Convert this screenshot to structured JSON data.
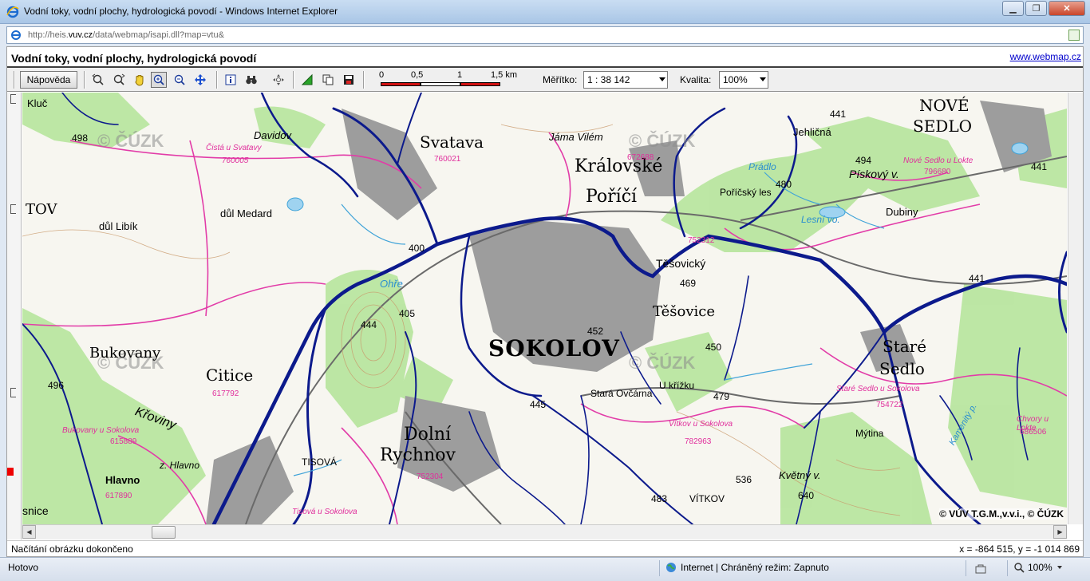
{
  "window": {
    "title": "Vodní toky, vodní plochy, hydrologická povodí - Windows Internet Explorer",
    "minimize": "▁",
    "maximize": "❐",
    "close": "✕"
  },
  "address": {
    "url_prefix": "http://heis.",
    "url_host": "vuv.cz",
    "url_rest": "/data/webmap/isapi.dll?map=vtu&"
  },
  "app": {
    "title": "Vodní toky, vodní plochy, hydrologická povodí",
    "link": "www.webmap.cz"
  },
  "toolbar": {
    "help_label": "Nápověda",
    "tools": [
      "zoom-in-step-icon",
      "zoom-out-step-icon",
      "pan-hand-icon",
      "zoom-in-icon",
      "zoom-out-icon",
      "full-extent-icon",
      "info-icon",
      "search-binoculars-icon",
      "center-icon",
      "select-icon",
      "copy-icon",
      "save-icon"
    ],
    "scale_labels": [
      "0",
      "0,5",
      "1",
      "1,5 km"
    ],
    "scale_label": "Měřítko:",
    "scale_value": "1 : 38 142",
    "quality_label": "Kvalita:",
    "quality_value": "100%"
  },
  "map": {
    "watermarks": [
      "© ČÚZK",
      "© ČÚZK",
      "© ČÚZK",
      "© ČÚZK"
    ],
    "labels": {
      "klic": "Kluč",
      "davidov": "Davidov",
      "cista": "Čistá u Svatavy",
      "cista_code": "760005",
      "svatava": "Svatava",
      "svatava_code": "760021",
      "jama": "Jáma Vilém",
      "kralovske": "Královské",
      "porici": "Poříčí",
      "code672688": "672688",
      "nove": "NOVÉ",
      "sedlo_top": "SEDLO",
      "jehlicna": "Jehličná",
      "pradlo": "Prádlo",
      "poricky": "Poříčský les",
      "piskovy": "Pískový v.",
      "nove_lokte": "Nové Sedlo u Lokte",
      "code796680": "796680",
      "dubiny": "Dubiny",
      "lesni": "Lesní vo.",
      "tov": "TOV",
      "dul_medard": "důl Medard",
      "dul_libik": "důl Libík",
      "ohre": "Ohře",
      "tesovicky": "Těšovický",
      "tesovice": "Těšovice",
      "code752312": "752312",
      "sokolov": "SOKOLOV",
      "bukovany": "Bukovany",
      "citice": "Citice",
      "code617792": "617792",
      "krovinny": "Křoviny",
      "bukovany_sok": "Bukovany u Sokolova",
      "code615889": "615889",
      "hlavno1": "z. Hlavno",
      "hlavno": "Hlavno",
      "code617890": "617890",
      "snice": "snice",
      "tisova": "TISOVÁ",
      "tisova_sok": "Tisová u Sokolova",
      "dolni": "Dolní",
      "rychnov": "Rychnov",
      "code752304": "752304",
      "u_krizku": "U křížku",
      "stara_ovcarna": "Stará Ovčárna",
      "vitkov_sok": "Vítkov u Sokolova",
      "code782963": "782963",
      "vitkov": "VÍTKOV",
      "stare": "Staré",
      "sedlo": "Sedlo",
      "stare_sok": "Staré Sedlo u Sokolova",
      "code754722": "754722",
      "mytina": "Mýtina",
      "kvetny": "Květný v.",
      "chvory": "Chvory u Lokte",
      "code686506": "686506",
      "kamenity": "Kamenitý p.",
      "stara_code": "Staré"
    },
    "elevations": [
      "498",
      "400",
      "444",
      "405",
      "452",
      "450",
      "469",
      "479",
      "445",
      "496",
      "441",
      "494",
      "480",
      "441",
      "441",
      "536",
      "483",
      "640"
    ],
    "copyright": "© VÚV T.G.M.,v.v.i., © ČÚZK"
  },
  "info": {
    "message": "Načítání obrázku dokončeno",
    "coords": "x = -864 515, y = -1 014 869"
  },
  "status": {
    "text": "Hotovo",
    "zone": "Internet | Chráněný režim: Zapnuto",
    "zoom": "100%"
  }
}
